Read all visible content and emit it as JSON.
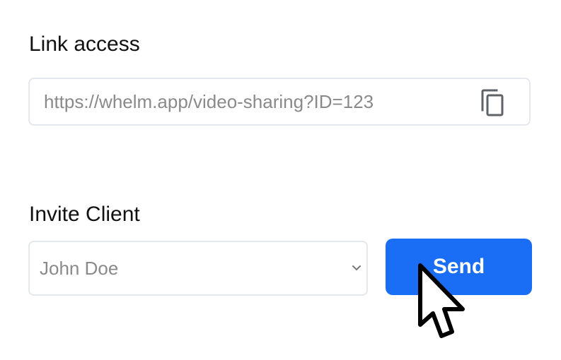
{
  "link_access": {
    "label": "Link access",
    "url": "https://whelm.app/video-sharing?ID=123",
    "copy_icon": "copy-icon"
  },
  "invite_client": {
    "label": "Invite Client",
    "selected_client": "John Doe",
    "dropdown_icon": "chevron-down-icon",
    "send_label": "Send"
  },
  "colors": {
    "accent": "#1a6ef5",
    "border": "#e6e8f0",
    "muted_text": "#8a8a8a"
  },
  "cursor_icon": "pointer-arrow-icon"
}
